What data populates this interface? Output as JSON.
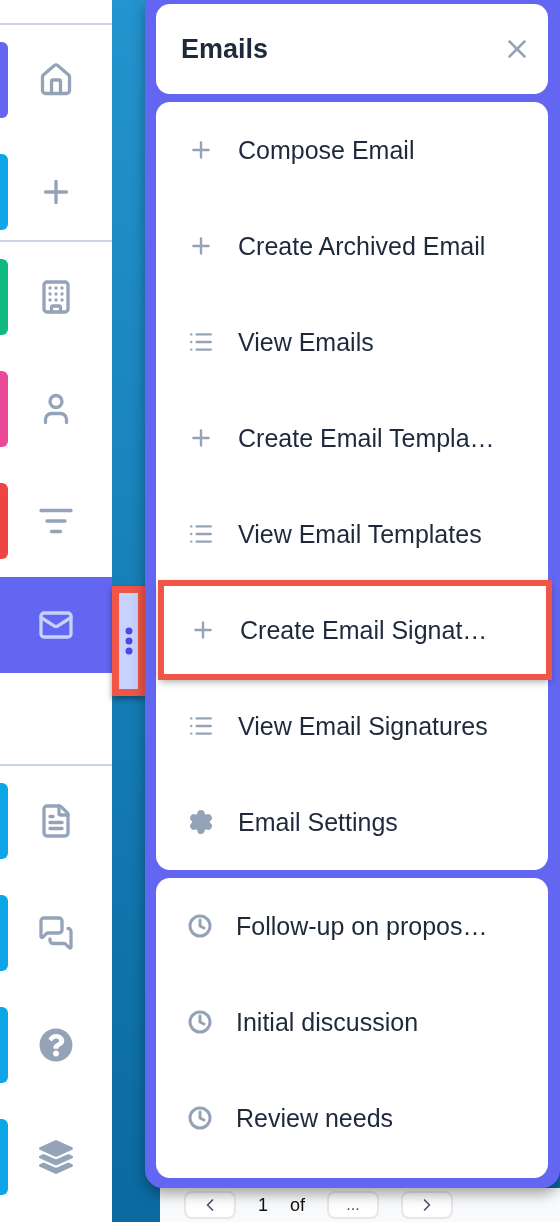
{
  "sidebar": {
    "groups": [
      {
        "items": [
          {
            "color": "#6366f1",
            "selected": false
          },
          {
            "color": "#0ea5e9",
            "selected": false
          }
        ]
      },
      {
        "items": [
          {
            "color": "#10b981",
            "selected": false
          },
          {
            "color": "#ec4899",
            "selected": false
          },
          {
            "color": "#ef4444",
            "selected": false
          },
          {
            "selected": true
          }
        ]
      },
      {
        "items": [
          {
            "color": "#0ea5e9",
            "selected": false
          },
          {
            "color": "#0ea5e9",
            "selected": false
          },
          {
            "color": "#0ea5e9",
            "selected": false
          },
          {
            "color": "#0ea5e9",
            "selected": false
          }
        ]
      }
    ]
  },
  "handle": {
    "highlighted": true
  },
  "panel": {
    "title": "Emails",
    "actions": [
      {
        "kind": "plus",
        "label": "Compose Email",
        "highlighted": false
      },
      {
        "kind": "plus",
        "label": "Create Archived Email",
        "highlighted": false
      },
      {
        "kind": "list",
        "label": "View Emails",
        "highlighted": false
      },
      {
        "kind": "plus",
        "label": "Create Email Templa…",
        "highlighted": false
      },
      {
        "kind": "list",
        "label": "View Email Templates",
        "highlighted": false
      },
      {
        "kind": "plus",
        "label": "Create Email Signat…",
        "highlighted": true
      },
      {
        "kind": "list",
        "label": "View Email Signatures",
        "highlighted": false
      },
      {
        "kind": "settings",
        "label": "Email Settings",
        "highlighted": false
      }
    ],
    "recent": [
      {
        "label": "Follow-up on propos…"
      },
      {
        "label": "Initial discussion"
      },
      {
        "label": "Review needs"
      }
    ]
  },
  "pagination": {
    "page": "1",
    "of": "of",
    "more": "..."
  }
}
